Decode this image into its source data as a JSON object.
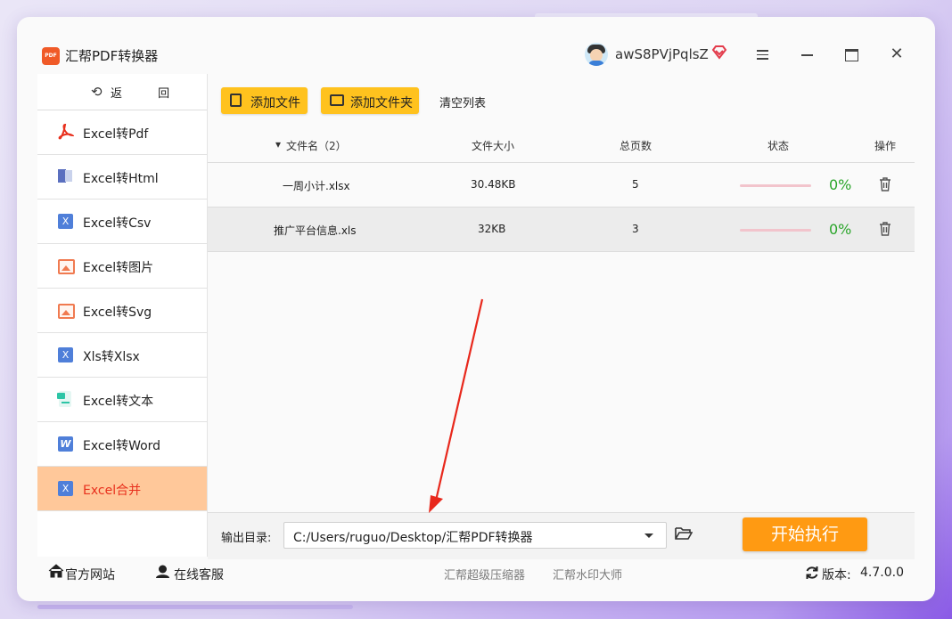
{
  "app": {
    "title": "汇帮PDF转换器",
    "logo_text": "PDF",
    "username": "awS8PVjPqlsZ"
  },
  "sidebar": {
    "back_label": "返 回",
    "items": [
      {
        "label": "Excel转Pdf",
        "icon": "pdf-icon"
      },
      {
        "label": "Excel转Html",
        "icon": "html-icon"
      },
      {
        "label": "Excel转Csv",
        "icon": "excel-x-icon"
      },
      {
        "label": "Excel转图片",
        "icon": "image-icon"
      },
      {
        "label": "Excel转Svg",
        "icon": "image-icon"
      },
      {
        "label": "Xls转Xlsx",
        "icon": "excel-x-icon"
      },
      {
        "label": "Excel转文本",
        "icon": "text-icon"
      },
      {
        "label": "Excel转Word",
        "icon": "word-icon"
      },
      {
        "label": "Excel合并",
        "icon": "excel-x-icon",
        "active": true
      }
    ]
  },
  "toolbar": {
    "add_file": "添加文件",
    "add_folder": "添加文件夹",
    "clear_list": "清空列表"
  },
  "table": {
    "headers": {
      "name": "文件名（2）",
      "size": "文件大小",
      "pages": "总页数",
      "status": "状态",
      "action": "操作"
    },
    "rows": [
      {
        "name": "一周小计.xlsx",
        "size": "30.48KB",
        "pages": "5",
        "progress": 0,
        "progress_label": "0%"
      },
      {
        "name": "推广平台信息.xls",
        "size": "32KB",
        "pages": "3",
        "progress": 0,
        "progress_label": "0%"
      }
    ]
  },
  "output": {
    "label": "输出目录:",
    "path": "C:/Users/ruguo/Desktop/汇帮PDF转换器",
    "start_button": "开始执行"
  },
  "footer": {
    "website": "官方网站",
    "support": "在线客服",
    "link1": "汇帮超级压缩器",
    "link2": "汇帮水印大师",
    "version_label": "版本:",
    "version": "4.7.0.0"
  },
  "colors": {
    "accent_yellow": "#ffc21e",
    "start_orange": "#ff9a12",
    "active_item_bg": "#ffc89a",
    "active_item_text": "#e8301d",
    "percent_green": "#2aa52a",
    "arrow_red": "#e8281c"
  }
}
